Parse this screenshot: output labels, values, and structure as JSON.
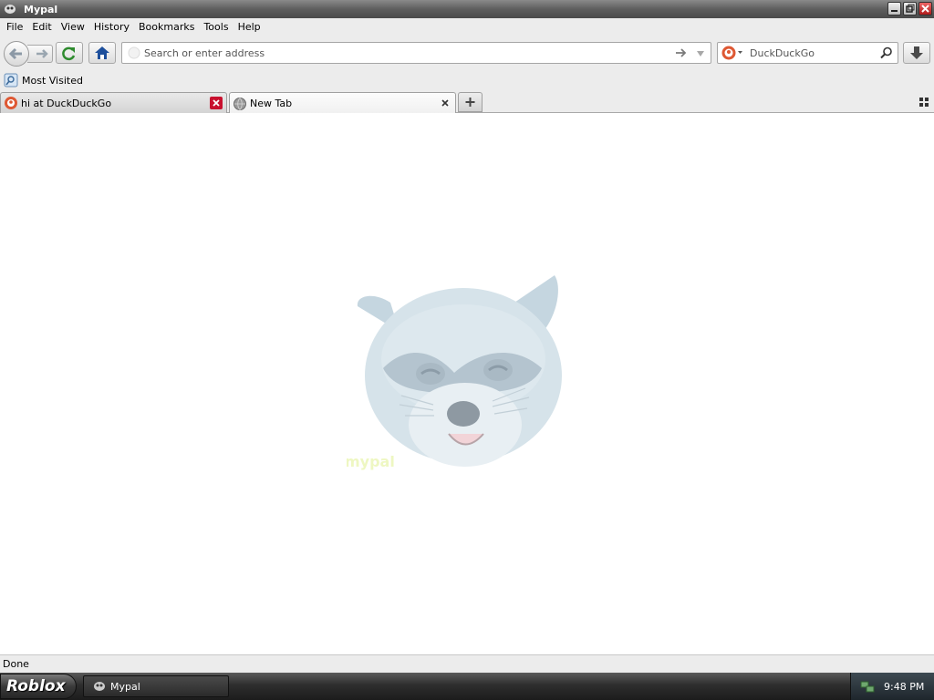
{
  "window": {
    "title": "Mypal"
  },
  "menu": [
    {
      "label": "File"
    },
    {
      "label": "Edit"
    },
    {
      "label": "View"
    },
    {
      "label": "History"
    },
    {
      "label": "Bookmarks"
    },
    {
      "label": "Tools"
    },
    {
      "label": "Help"
    }
  ],
  "navbar": {
    "url_placeholder": "Search or enter address",
    "url_value": "",
    "search_engine": "DuckDuckGo"
  },
  "bookmarks": {
    "most_visited": "Most Visited"
  },
  "tabs": [
    {
      "label": "hi at DuckDuckGo",
      "active": false
    },
    {
      "label": "New Tab",
      "active": true
    }
  ],
  "content": {
    "logo_text": "mypal"
  },
  "statusbar": {
    "text": "Done"
  },
  "taskbar": {
    "start_label": "Roblox",
    "task_label": "Mypal",
    "clock": "9:48 PM"
  },
  "colors": {
    "duckduckgo": "#de5833",
    "close_tab_red": "#c8102e",
    "home_blue": "#1d4f9c",
    "reload_green": "#2e8b2e"
  }
}
